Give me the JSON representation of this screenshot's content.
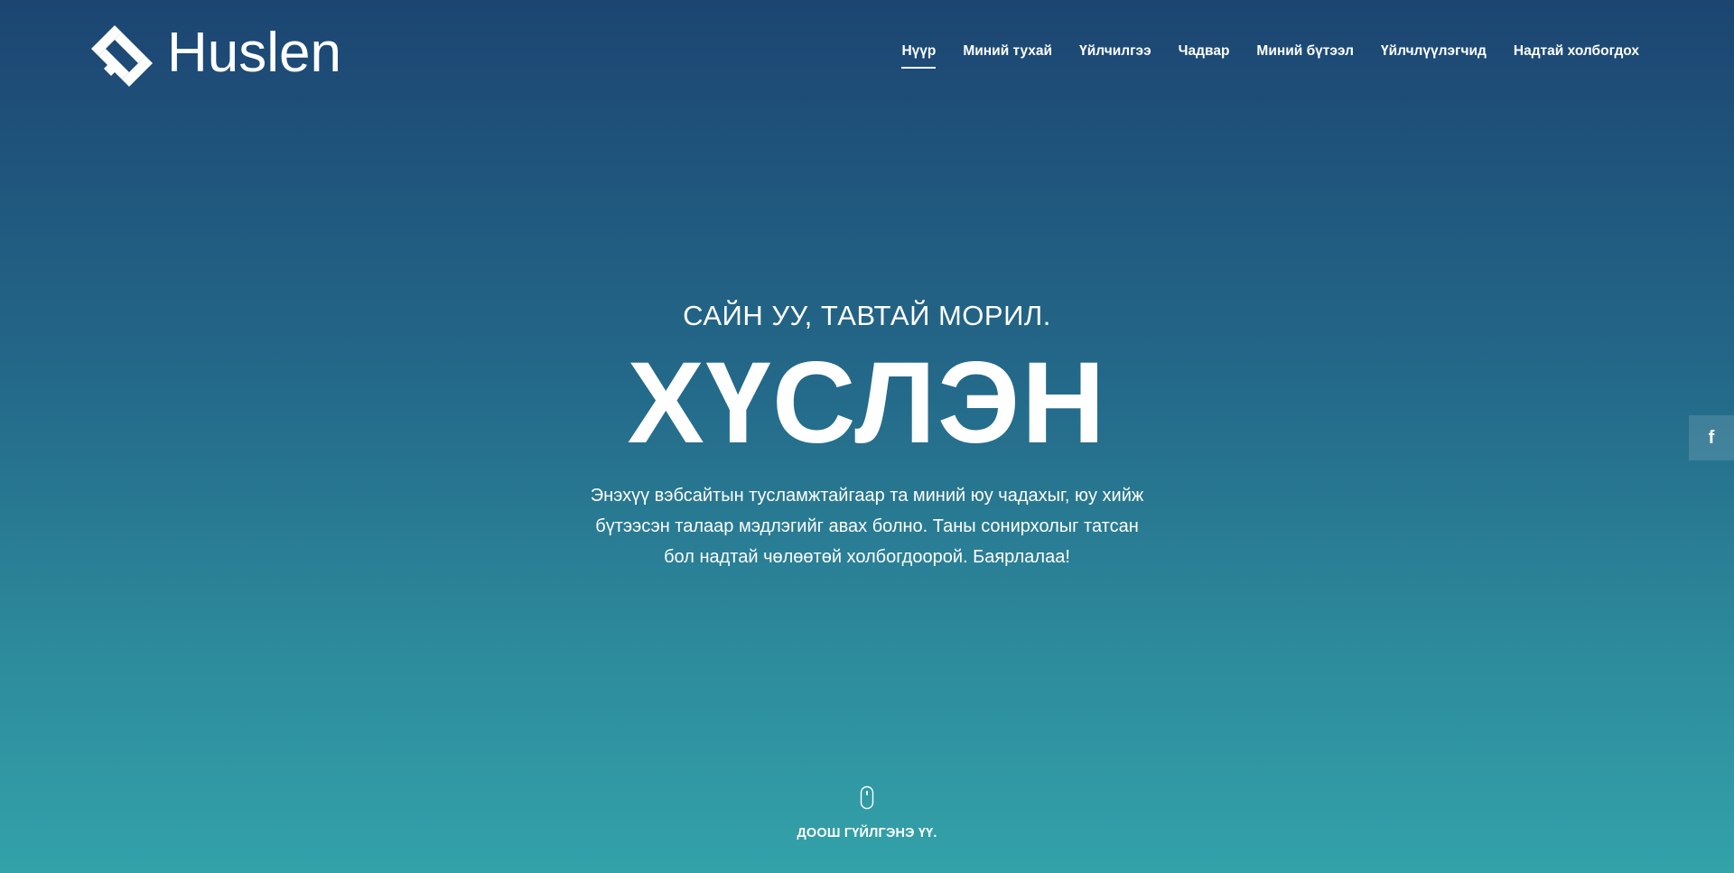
{
  "brand": {
    "name": "Huslen",
    "logo_icon": "huslen-logo-mark"
  },
  "nav": {
    "items": [
      {
        "label": "Нүүр",
        "active": true
      },
      {
        "label": "Миний тухай",
        "active": false
      },
      {
        "label": "Үйлчилгээ",
        "active": false
      },
      {
        "label": "Чадвар",
        "active": false
      },
      {
        "label": "Миний бүтээл",
        "active": false
      },
      {
        "label": "Үйлчлүүлэгчид",
        "active": false
      },
      {
        "label": "Надтай холбогдох",
        "active": false
      }
    ]
  },
  "hero": {
    "greeting": "САЙН УУ, ТАВТАЙ МОРИЛ.",
    "title": "ХҮСЛЭН",
    "description": "Энэхүү вэбсайтын тусламжтайгаар та миний юу чадахыг, юу хийж бүтээсэн талаар мэдлэгийг авах болно. Таны сонирхолыг татсан бол надтай чөлөөтөй холбогдоорой. Баярлалаа!"
  },
  "social": {
    "facebook_icon": "facebook-icon",
    "facebook_glyph": "f"
  },
  "scroll": {
    "icon": "mouse-icon",
    "label": "ДООШ ГҮЙЛГЭНЭ ҮҮ."
  },
  "colors": {
    "gradient_top": "#1c4572",
    "gradient_bottom": "#33a2a9",
    "text": "#ffffff"
  }
}
